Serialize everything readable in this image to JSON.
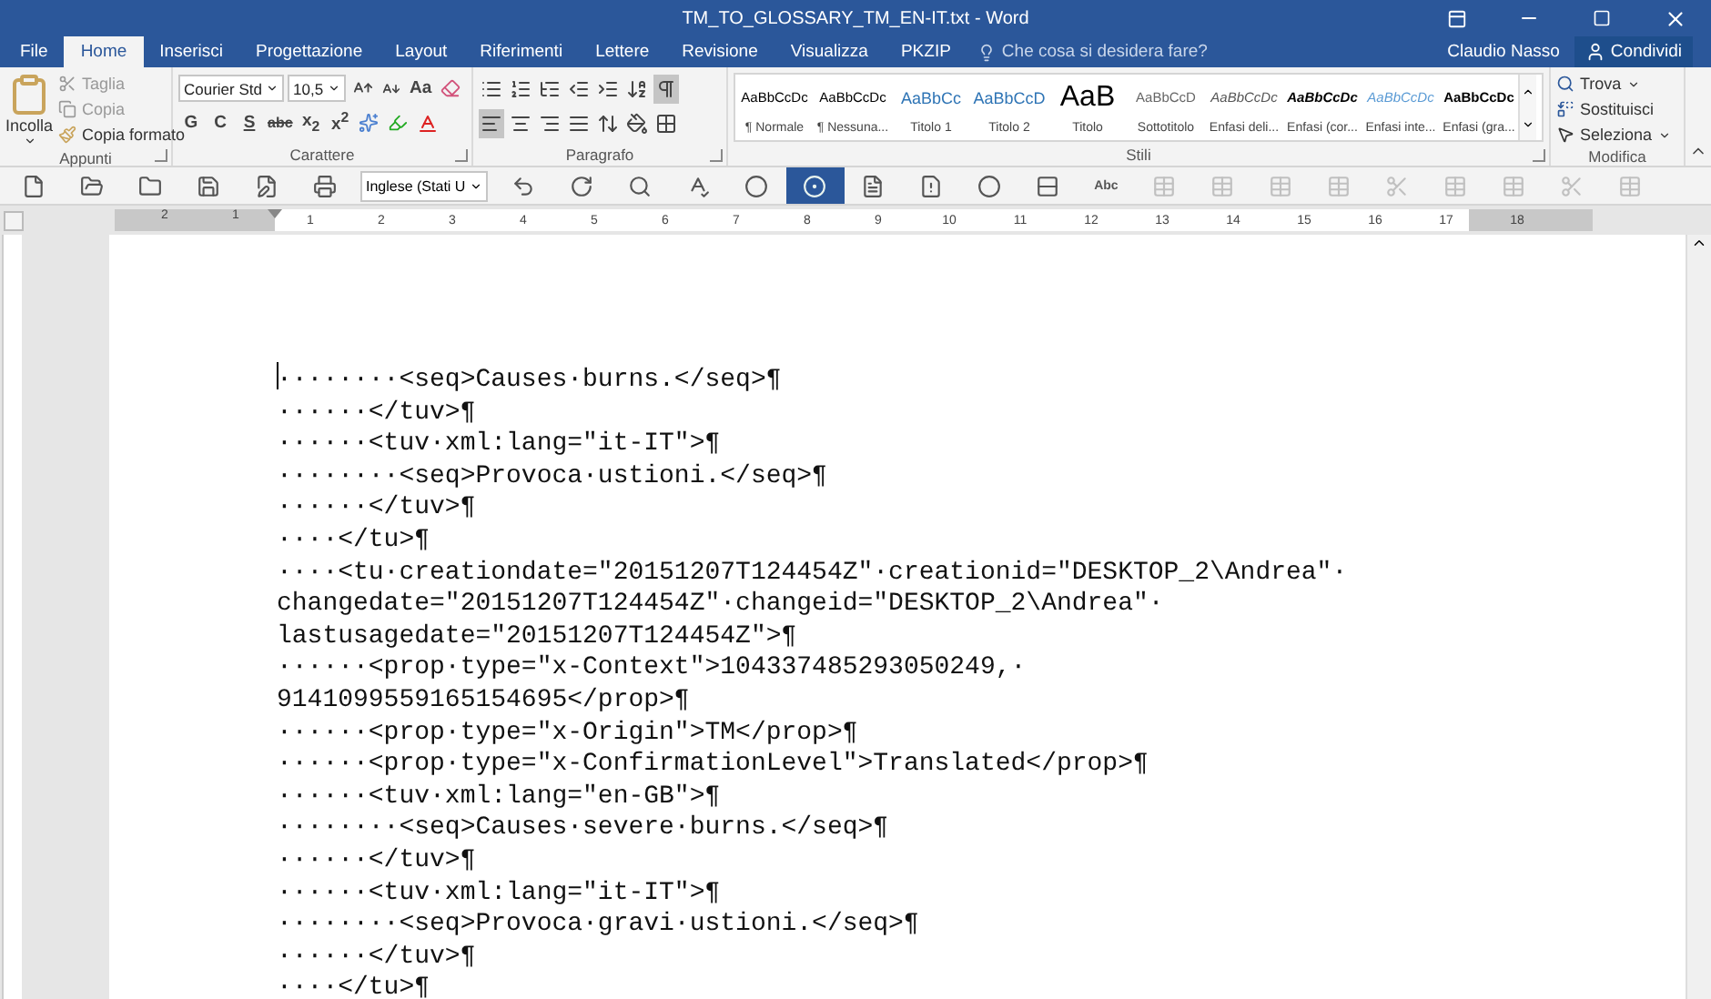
{
  "window": {
    "title": "TM_TO_GLOSSARY_TM_EN-IT.txt - Word"
  },
  "tabs": [
    {
      "label": "File",
      "selected": false
    },
    {
      "label": "Home",
      "selected": true
    },
    {
      "label": "Inserisci",
      "selected": false
    },
    {
      "label": "Progettazione",
      "selected": false
    },
    {
      "label": "Layout",
      "selected": false
    },
    {
      "label": "Riferimenti",
      "selected": false
    },
    {
      "label": "Lettere",
      "selected": false
    },
    {
      "label": "Revisione",
      "selected": false
    },
    {
      "label": "Visualizza",
      "selected": false
    },
    {
      "label": "PKZIP",
      "selected": false
    }
  ],
  "tell_me": {
    "placeholder": "Che cosa si desidera fare?"
  },
  "user": {
    "name": "Claudio Nasso"
  },
  "share_button": {
    "label": "Condividi"
  },
  "ribbon": {
    "clipboard": {
      "label": "Appunti",
      "paste": "Incolla",
      "cut": "Taglia",
      "copy": "Copia",
      "format_painter": "Copia formato"
    },
    "font": {
      "label": "Carattere",
      "font_name": "Courier Std",
      "font_size": "10,5",
      "change_case": "Aa",
      "bold": "G",
      "italic": "C",
      "underline": "S",
      "strikethrough": "abc",
      "subscript": "x$_{2}$",
      "superscript": "x$^{2}$"
    },
    "paragraph": {
      "label": "Paragrafo",
      "show_marks": true,
      "alignments": [
        {
          "selected": true
        },
        {
          "selected": false
        },
        {
          "selected": false
        },
        {
          "selected": false
        }
      ]
    },
    "styles": {
      "label": "Stili",
      "items": [
        {
          "kind": "normal",
          "preview": "AaBbCcDc",
          "name": "¶ Normale"
        },
        {
          "kind": "normal",
          "preview": "AaBbCcDc",
          "name": "¶ Nessuna..."
        },
        {
          "kind": "heading1",
          "preview": "AaBbCc",
          "name": "Titolo 1"
        },
        {
          "kind": "heading2",
          "preview": "AaBbCcD",
          "name": "Titolo 2"
        },
        {
          "kind": "title",
          "preview": "AaB",
          "name": "Titolo"
        },
        {
          "kind": "subtitle",
          "preview": "AaBbCcD",
          "name": "Sottotitolo"
        },
        {
          "kind": "subtle",
          "preview": "AaBbCcDc",
          "name": "Enfasi deli..."
        },
        {
          "kind": "emphasis",
          "preview": "AaBbCcDc",
          "name": "Enfasi (cor..."
        },
        {
          "kind": "intense",
          "preview": "AaBbCcDc",
          "name": "Enfasi inte..."
        },
        {
          "kind": "strong",
          "preview": "AaBbCcDc",
          "name": "Enfasi (gra..."
        }
      ]
    },
    "editing": {
      "label": "Modifica",
      "find": "Trova",
      "replace": "Sostituisci",
      "select": "Seleziona"
    }
  },
  "toolbar": {
    "tools": [
      {
        "kind": "new",
        "selected": false,
        "disabled": false
      },
      {
        "kind": "open",
        "selected": false,
        "disabled": false
      },
      {
        "kind": "folder",
        "selected": false,
        "disabled": false
      },
      {
        "kind": "save",
        "selected": false,
        "disabled": false
      },
      {
        "kind": "save-edit",
        "selected": false,
        "disabled": false
      },
      {
        "kind": "print",
        "selected": false,
        "disabled": false
      },
      {
        "kind": "language",
        "label": "Inglese (Stati U"
      },
      {
        "kind": "undo",
        "selected": false,
        "disabled": false
      },
      {
        "kind": "redo",
        "selected": false,
        "disabled": false
      },
      {
        "kind": "search",
        "selected": false,
        "disabled": false
      },
      {
        "kind": "spell",
        "selected": false,
        "disabled": false
      },
      {
        "kind": "circle",
        "selected": false,
        "disabled": false
      },
      {
        "kind": "circle",
        "selected": true,
        "disabled": false
      },
      {
        "kind": "doc",
        "selected": false,
        "disabled": false
      },
      {
        "kind": "doc-warning",
        "selected": false,
        "disabled": false
      },
      {
        "kind": "circle",
        "selected": false,
        "disabled": false
      },
      {
        "kind": "split",
        "selected": false,
        "disabled": false
      },
      {
        "kind": "text",
        "label": "Abc",
        "selected": false,
        "disabled": false
      },
      {
        "kind": "table",
        "selected": false,
        "disabled": true
      },
      {
        "kind": "table",
        "selected": false,
        "disabled": true
      },
      {
        "kind": "table",
        "selected": false,
        "disabled": true
      },
      {
        "kind": "table",
        "selected": false,
        "disabled": true
      },
      {
        "kind": "cut",
        "selected": false,
        "disabled": true
      },
      {
        "kind": "table",
        "selected": false,
        "disabled": true
      },
      {
        "kind": "table",
        "selected": false,
        "disabled": true
      },
      {
        "kind": "cut",
        "selected": false,
        "disabled": true
      },
      {
        "kind": "table",
        "selected": false,
        "disabled": true
      }
    ]
  },
  "ruler": {
    "left_labels": [
      "2",
      "1"
    ],
    "right_labels": [
      "1",
      "2",
      "3",
      "4",
      "5",
      "6",
      "7",
      "8",
      "9",
      "10",
      "11",
      "12",
      "13",
      "14",
      "15",
      "16",
      "17",
      "18"
    ]
  },
  "document": {
    "lines": [
      "········<seq>Causes·burns.</seq>¶",
      "······</tuv>¶",
      "······<tuv·xml:lang=\"it-IT\">¶",
      "········<seq>Provoca·ustioni.</seq>¶",
      "······</tuv>¶",
      "····</tu>¶",
      "····<tu·creationdate=\"20151207T124454Z\"·creationid=\"DESKTOP_2\\Andrea\"·",
      "changedate=\"20151207T124454Z\"·changeid=\"DESKTOP_2\\Andrea\"·",
      "lastusagedate=\"20151207T124454Z\">¶",
      "······<prop·type=\"x-Context\">104337485293050249,·",
      "9141099559165154695</prop>¶",
      "······<prop·type=\"x-Origin\">TM</prop>¶",
      "······<prop·type=\"x-ConfirmationLevel\">Translated</prop>¶",
      "······<tuv·xml:lang=\"en-GB\">¶",
      "········<seq>Causes·severe·burns.</seq>¶",
      "······</tuv>¶",
      "······<tuv·xml:lang=\"it-IT\">¶",
      "········<seq>Provoca·gravi·ustioni.</seq>¶",
      "······</tuv>¶",
      "····</tu>¶"
    ]
  }
}
